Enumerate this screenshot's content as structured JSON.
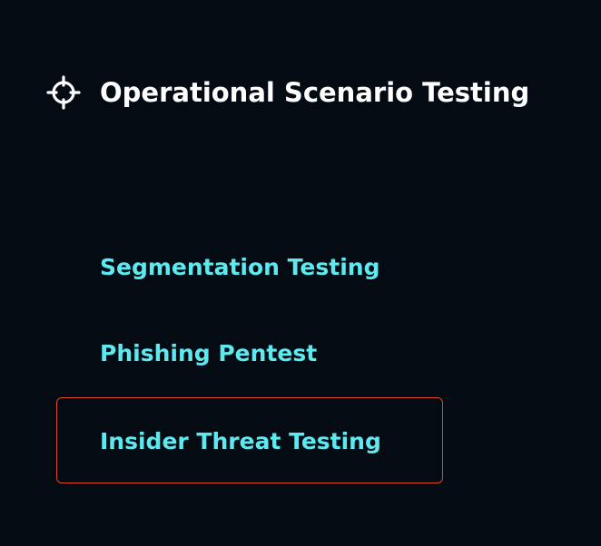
{
  "header": {
    "title": "Operational Scenario Testing",
    "icon": "crosshair-icon"
  },
  "menu": {
    "items": [
      {
        "label": "Segmentation Testing"
      },
      {
        "label": "Phishing Pentest"
      },
      {
        "label": "Insider Threat Testing",
        "focused": true
      }
    ]
  },
  "colors": {
    "background": "#050b13",
    "title": "#ffffff",
    "link": "#5ee9f0",
    "focus_border": "#e0472c"
  }
}
